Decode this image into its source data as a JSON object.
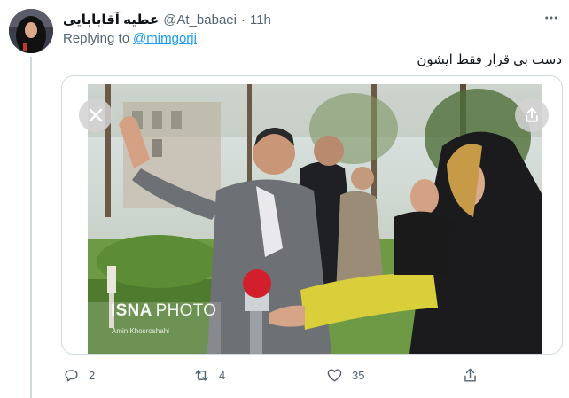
{
  "tweet": {
    "author_name": "عطیه آقابابایی",
    "handle": "@At_babaei",
    "separator": "·",
    "time": "11h",
    "replying_prefix": "Replying to",
    "replying_to": "@mimgorji",
    "text": "دست بی قرار فقط ایشون",
    "media": {
      "watermark_brand": "ISNA",
      "watermark_suffix": "PHOTO",
      "credit": "Amin Khosroshahi"
    },
    "actions": {
      "reply_count": "2",
      "retweet_count": "4",
      "like_count": "35",
      "share_count": ""
    }
  },
  "icons": {
    "more": "more-horizontal-icon",
    "close": "close-icon",
    "image_share": "share-icon",
    "reply": "reply-icon",
    "retweet": "retweet-icon",
    "like": "heart-icon",
    "share": "share-icon"
  },
  "colors": {
    "link": "#1d9bf0",
    "secondary_text": "#536471",
    "border": "#cfd9de"
  }
}
